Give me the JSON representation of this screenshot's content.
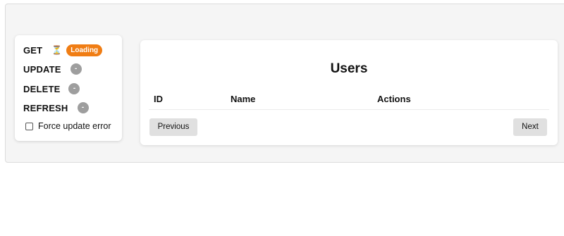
{
  "status_panel": {
    "items": [
      {
        "method": "GET",
        "icon": "hourglass-icon",
        "icon_glyph": "⏳",
        "badge": "Loading",
        "badge_color": "#f07d14"
      },
      {
        "method": "UPDATE",
        "badge": "-"
      },
      {
        "method": "DELETE",
        "badge": "-"
      },
      {
        "method": "REFRESH",
        "badge": "-"
      }
    ],
    "force_error_label": "Force update error",
    "force_error_checked": false
  },
  "users_table": {
    "title": "Users",
    "columns": [
      "ID",
      "Name",
      "Actions"
    ],
    "rows": [],
    "prev_label": "Previous",
    "next_label": "Next"
  },
  "colors": {
    "loading_badge": "#f07d14",
    "idle_badge": "#9e9e9e",
    "button_bg": "#e0e0e0"
  }
}
